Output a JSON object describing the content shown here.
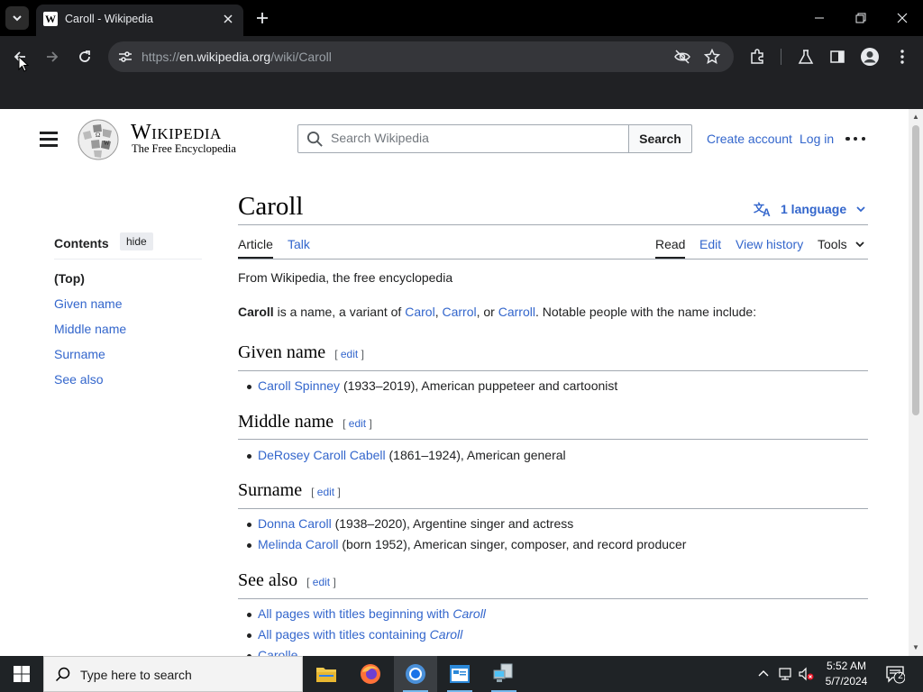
{
  "browser": {
    "tab_title": "Caroll - Wikipedia",
    "tab_favicon_letter": "W",
    "url_prefix": "https://",
    "url_host": "en.wikipedia.org",
    "url_path": "/wiki/Caroll"
  },
  "header": {
    "wordmark": "Wikipedia",
    "tagline": "The Free Encyclopedia",
    "search_placeholder": "Search Wikipedia",
    "search_button": "Search",
    "create_account": "Create account",
    "log_in": "Log in"
  },
  "toc": {
    "title": "Contents",
    "hide": "hide",
    "items": [
      "(Top)",
      "Given name",
      "Middle name",
      "Surname",
      "See also"
    ]
  },
  "article": {
    "title": "Caroll",
    "language_button": "1 language",
    "tabs": {
      "article": "Article",
      "talk": "Talk",
      "read": "Read",
      "edit": "Edit",
      "view_history": "View history",
      "tools": "Tools"
    },
    "tagline": "From Wikipedia, the free encyclopedia",
    "intro": {
      "bold": "Caroll",
      "t1": " is a name, a variant of ",
      "l1": "Carol",
      "t2": ", ",
      "l2": "Carrol",
      "t3": ", or ",
      "l3": "Carroll",
      "t4": ". Notable people with the name include:"
    },
    "edit_open": "[",
    "edit_label": "edit",
    "edit_close": "]",
    "sections": {
      "given": {
        "heading": "Given name",
        "items": [
          {
            "link": "Caroll Spinney",
            "rest": " (1933–2019), American puppeteer and cartoonist"
          }
        ]
      },
      "middle": {
        "heading": "Middle name",
        "items": [
          {
            "link": "DeRosey Caroll Cabell",
            "rest": " (1861–1924), American general"
          }
        ]
      },
      "surname": {
        "heading": "Surname",
        "items": [
          {
            "link": "Donna Caroll",
            "rest": " (1938–2020), Argentine singer and actress"
          },
          {
            "link": "Melinda Caroll",
            "rest": " (born 1952), American singer, composer, and record producer"
          }
        ]
      },
      "see_also": {
        "heading": "See also",
        "items": [
          {
            "link": "All pages with titles beginning with ",
            "em": "Caroll"
          },
          {
            "link": "All pages with titles containing ",
            "em": "Caroll"
          },
          {
            "link": "Carolle",
            "em": ""
          }
        ]
      }
    }
  },
  "taskbar": {
    "search_text": "Type here to search",
    "time": "5:52 AM",
    "date": "5/7/2024",
    "notification_count": "2"
  }
}
